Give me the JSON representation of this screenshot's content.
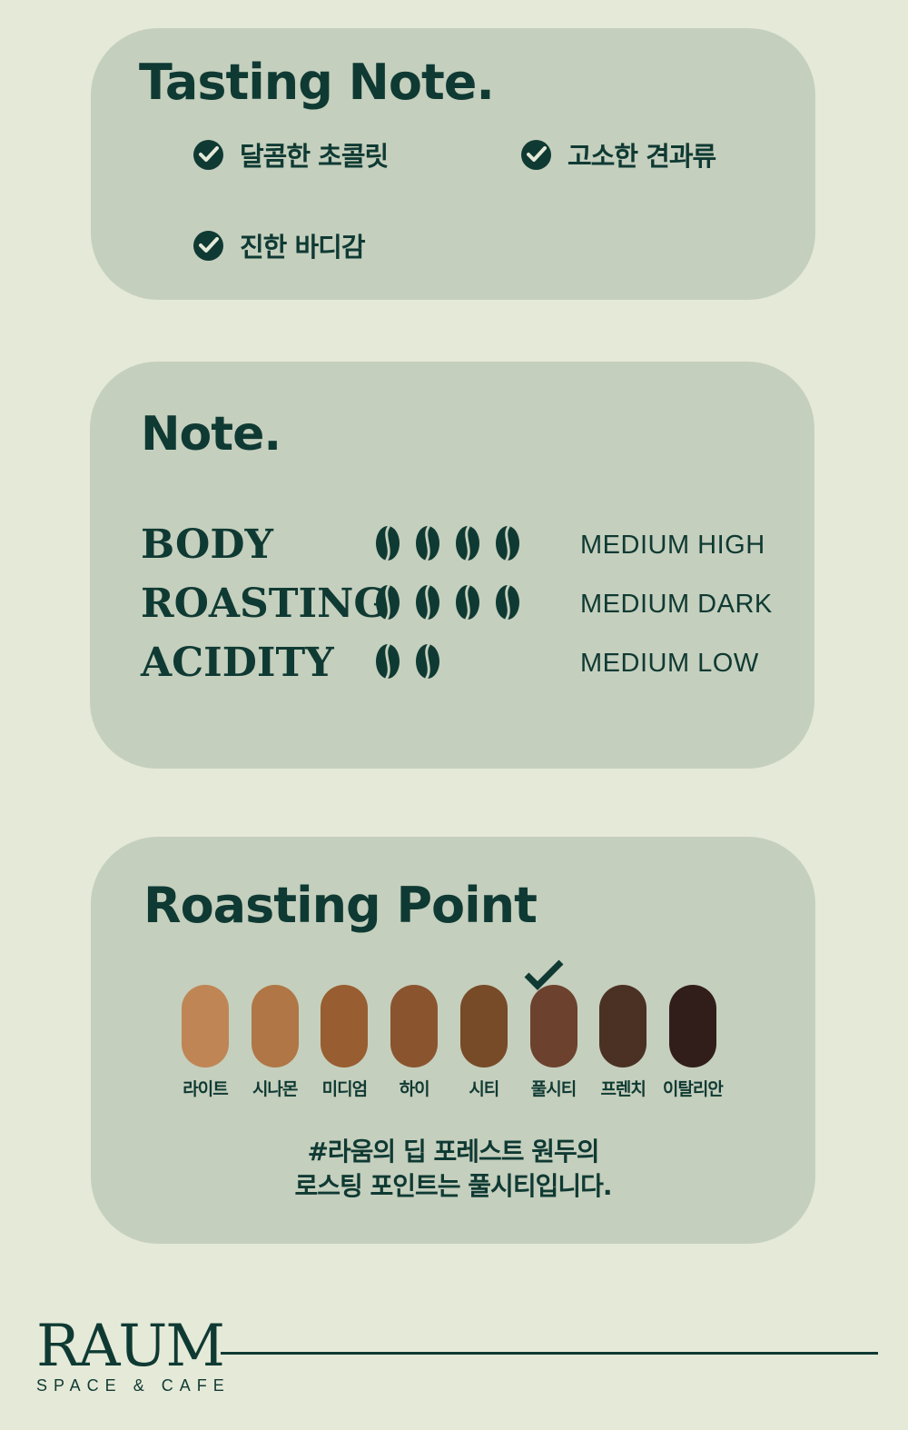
{
  "tasting_note": {
    "title": "Tasting Note.",
    "items": [
      "달콤한 초콜릿",
      "고소한 견과류",
      "진한 바디감"
    ]
  },
  "note": {
    "title": "Note.",
    "rows": [
      {
        "label": "BODY",
        "beans": 4,
        "level": "MEDIUM HIGH"
      },
      {
        "label": "ROASTING",
        "beans": 4,
        "level": "MEDIUM DARK"
      },
      {
        "label": "ACIDITY",
        "beans": 2,
        "level": "MEDIUM LOW"
      }
    ]
  },
  "roasting_point": {
    "title": "Roasting Point",
    "selected": "풀시티",
    "stages": [
      {
        "name": "라이트",
        "color": "#bf8555"
      },
      {
        "name": "시나몬",
        "color": "#b07645"
      },
      {
        "name": "미디엄",
        "color": "#985d30"
      },
      {
        "name": "하이",
        "color": "#8a542f"
      },
      {
        "name": "시티",
        "color": "#774a28"
      },
      {
        "name": "풀시티",
        "color": "#6c412d"
      },
      {
        "name": "프렌치",
        "color": "#4a3123"
      },
      {
        "name": "이탈리안",
        "color": "#311e1b"
      }
    ],
    "caption_line1": "#라움의 딥 포레스트 원두의",
    "caption_line2": "로스팅 포인트는 풀시티입니다."
  },
  "brand": {
    "name": "RAUM",
    "tagline": "SPACE & CAFE"
  },
  "colors": {
    "background": "#e5e9d7",
    "card": "#c5cfbd",
    "primary": "#0f3a33"
  }
}
